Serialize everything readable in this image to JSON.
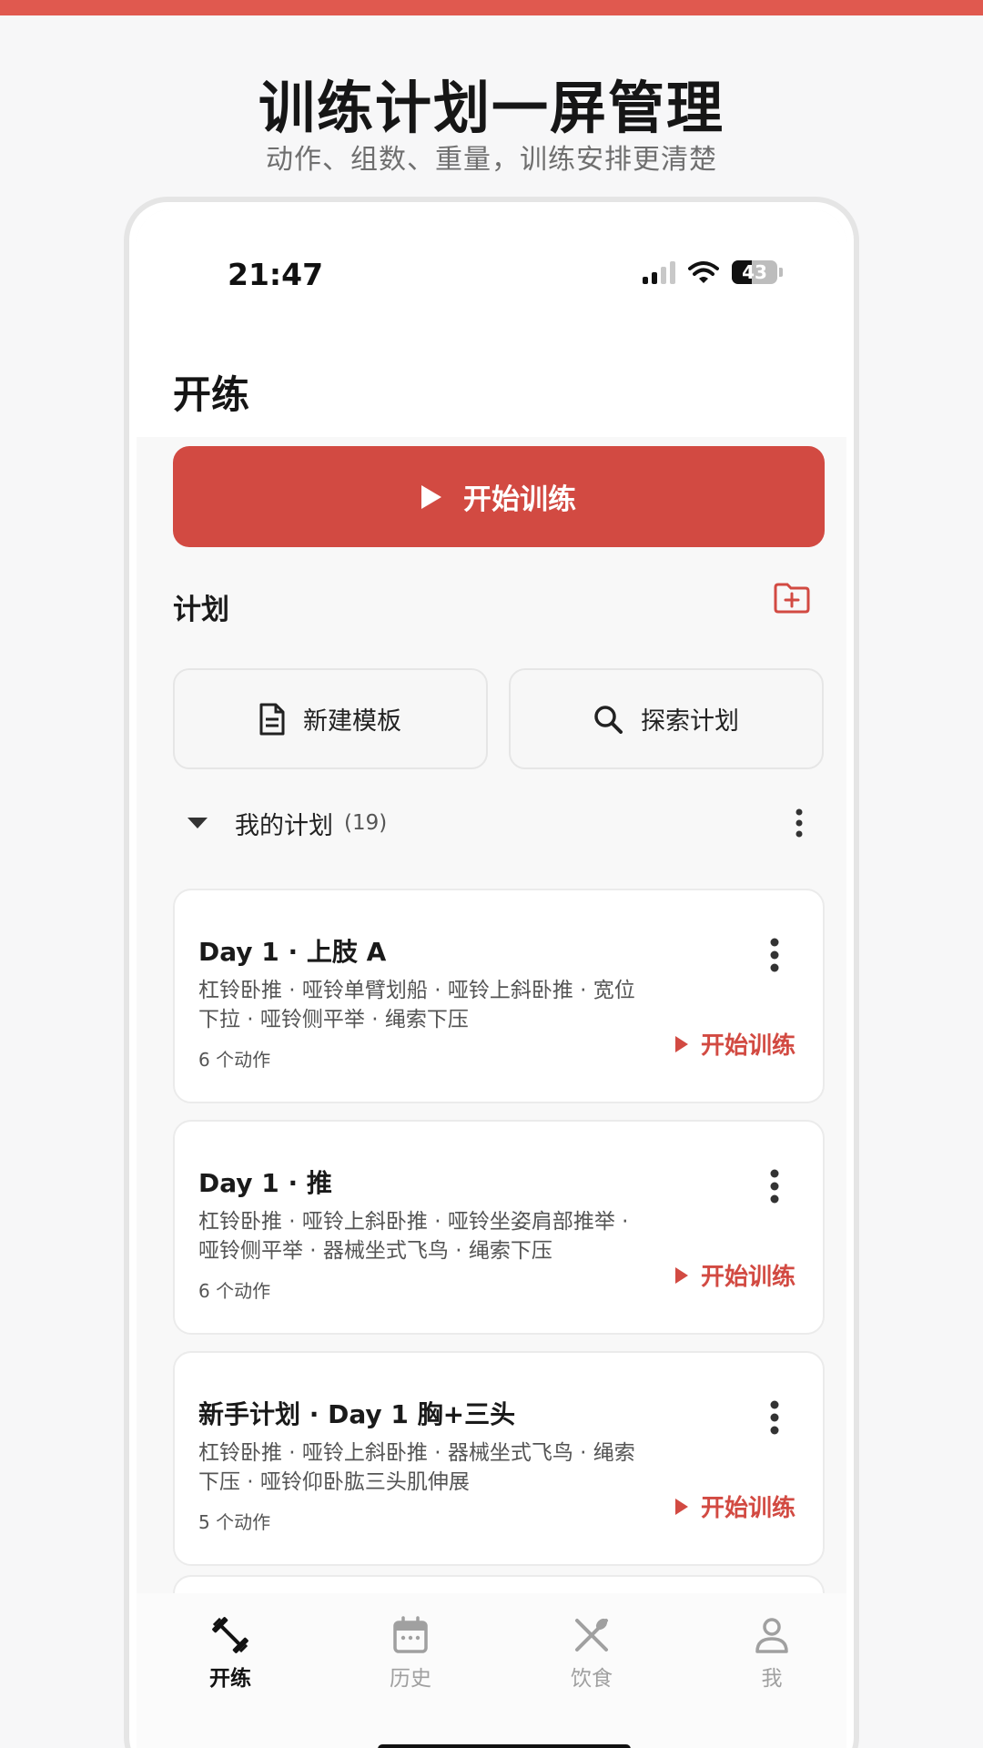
{
  "promo": {
    "title": "训练计划一屏管理",
    "subtitle": "动作、组数、重量，训练安排更清楚"
  },
  "status_bar": {
    "time": "21:47",
    "battery": "43"
  },
  "header": {
    "title": "开练"
  },
  "start_button": {
    "label": "开始训练"
  },
  "plans_section": {
    "label": "计划",
    "new_template_label": "新建模板",
    "explore_label": "探索计划"
  },
  "my_plans": {
    "label": "我的计划",
    "count": "(19)"
  },
  "cards": [
    {
      "title": "Day 1 · 上肢 A",
      "exercises": "杠铃卧推 · 哑铃单臂划船 · 哑铃上斜卧推 · 宽位下拉 · 哑铃侧平举 · 绳索下压",
      "count": "6 个动作",
      "start_label": "开始训练"
    },
    {
      "title": "Day 1 · 推",
      "exercises": "杠铃卧推 · 哑铃上斜卧推 · 哑铃坐姿肩部推举 · 哑铃侧平举 · 器械坐式飞鸟 · 绳索下压",
      "count": "6 个动作",
      "start_label": "开始训练"
    },
    {
      "title": "新手计划 · Day 1 胸+三头",
      "exercises": "杠铃卧推 · 哑铃上斜卧推 · 器械坐式飞鸟 · 绳索下压 · 哑铃仰卧肱三头肌伸展",
      "count": "5 个动作",
      "start_label": "开始训练"
    }
  ],
  "tabs": [
    {
      "label": "开练",
      "icon": "dumbbell-icon",
      "active": true
    },
    {
      "label": "历史",
      "icon": "calendar-icon",
      "active": false
    },
    {
      "label": "饮食",
      "icon": "utensils-icon",
      "active": false
    },
    {
      "label": "我",
      "icon": "person-icon",
      "active": false
    }
  ],
  "colors": {
    "accent": "#d24a42",
    "top_stripe": "#e0594f"
  }
}
